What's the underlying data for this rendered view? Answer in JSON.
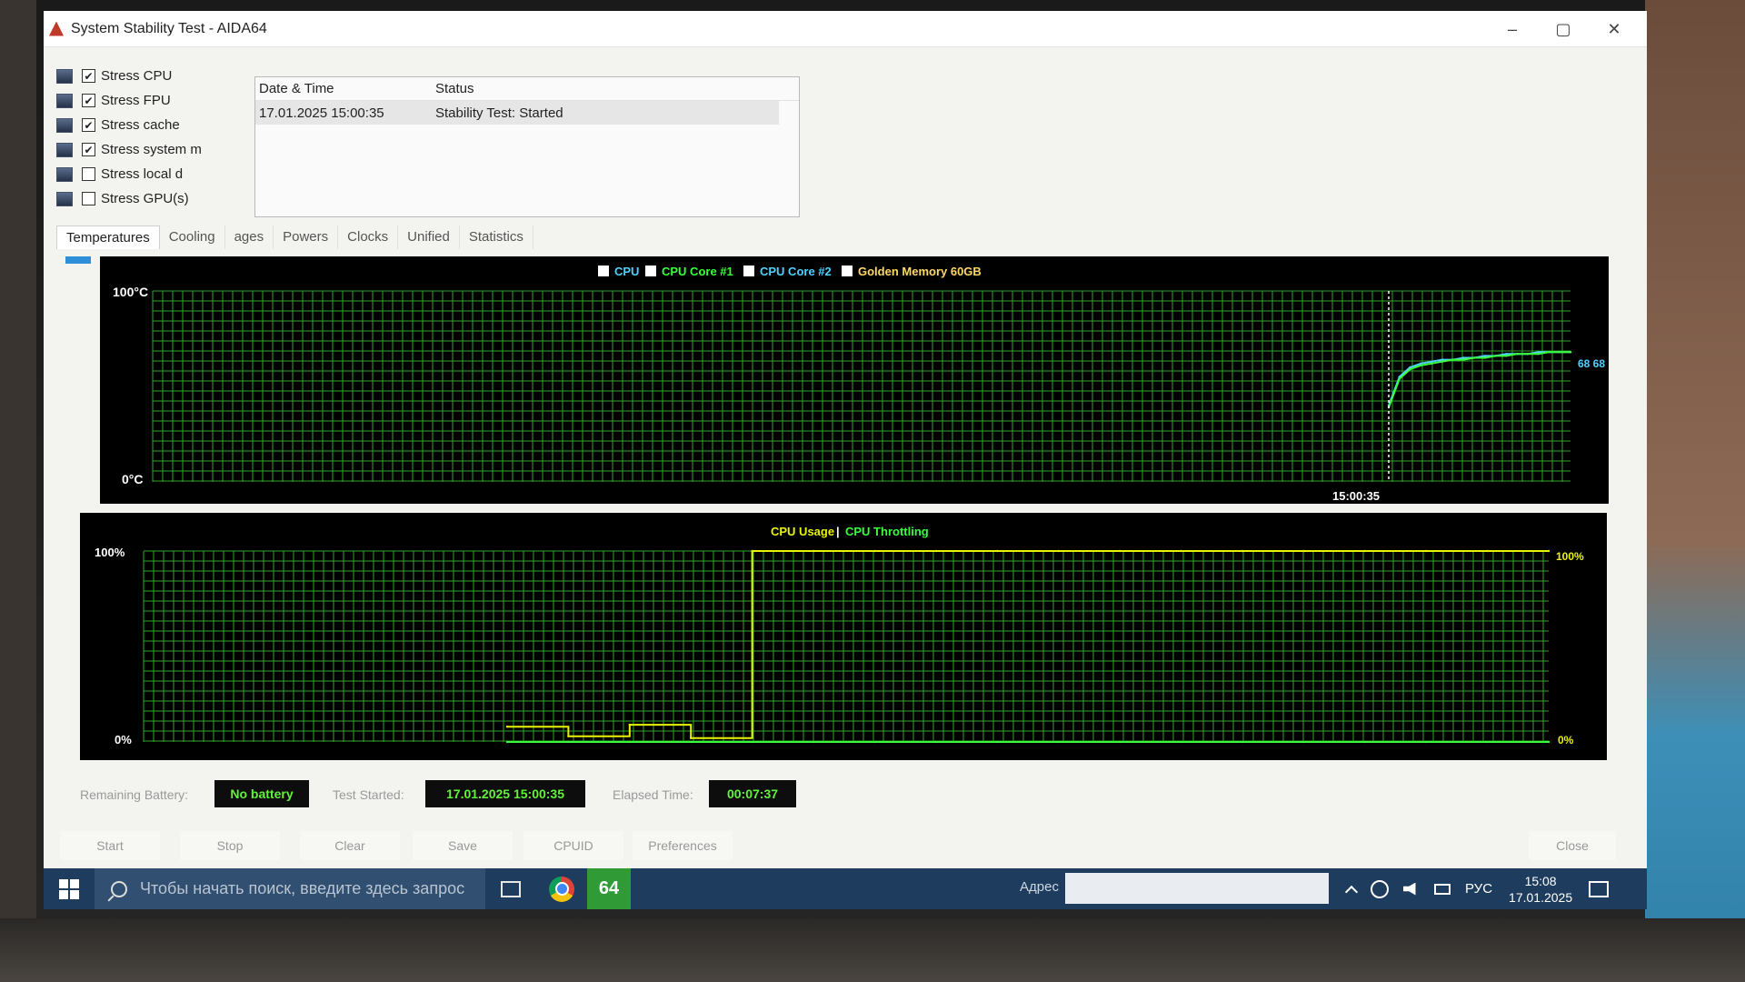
{
  "window": {
    "title": "System Stability Test - AIDA64",
    "controls": [
      "–",
      "▢",
      "✕"
    ]
  },
  "stress_options": [
    {
      "label": "Stress CPU",
      "checked": true,
      "icon": "cpu-icon"
    },
    {
      "label": "Stress FPU",
      "checked": true,
      "icon": "fpu-icon"
    },
    {
      "label": "Stress cache",
      "checked": true,
      "icon": "cache-icon"
    },
    {
      "label": "Stress system m",
      "checked": true,
      "icon": "memory-icon"
    },
    {
      "label": "Stress local d",
      "checked": false,
      "icon": "disk-icon"
    },
    {
      "label": "Stress GPU(s)",
      "checked": false,
      "icon": "gpu-icon"
    }
  ],
  "log": {
    "headers": {
      "datetime": "Date & Time",
      "status": "Status"
    },
    "rows": [
      {
        "datetime": "17.01.2025 15:00:35",
        "status": "Stability Test: Started"
      }
    ]
  },
  "tabs": [
    "Temperatures",
    "Cooling",
    "ages",
    "Powers",
    "Clocks",
    "Unified",
    "Statistics"
  ],
  "temperature_chart": {
    "legend": [
      {
        "label": "CPU",
        "checked": true,
        "color": "#4fd1ff"
      },
      {
        "label": "CPU Core #1",
        "checked": true,
        "color": "#39ff3a"
      },
      {
        "label": "CPU Core #2",
        "checked": true,
        "color": "#4fd1ff"
      },
      {
        "label": "Golden Memory 60GB",
        "checked": false,
        "color": "#ffd966"
      }
    ],
    "y_top_label": "100°C",
    "y_bottom_label": "0°C",
    "marker_time_label": "15:00:35",
    "value_label": "68 68"
  },
  "cpu_chart": {
    "title_usage": "CPU Usage",
    "title_sep": "|",
    "title_throttling": "CPU Throttling",
    "y_top_label": "100%",
    "y_bottom_label": "0%",
    "right_top_label": "100%",
    "right_bottom_label": "0%"
  },
  "chart_data": [
    {
      "type": "line",
      "title": "",
      "ylim": [
        0,
        100
      ],
      "ylabel": "°C",
      "grid": true,
      "marker_time": "15:00:35",
      "series": [
        {
          "name": "CPU",
          "color": "#4fd1ff",
          "values": [
            40,
            55,
            60,
            62,
            63,
            64,
            64,
            65,
            65,
            66,
            66,
            67,
            67,
            67,
            68,
            68,
            68,
            68
          ]
        },
        {
          "name": "CPU Core #1",
          "color": "#39ff3a",
          "values": [
            39,
            54,
            59,
            61,
            62,
            63,
            64,
            64,
            65,
            65,
            66,
            66,
            67,
            67,
            67,
            68,
            68,
            68
          ]
        }
      ]
    },
    {
      "type": "line",
      "title": "",
      "ylim": [
        0,
        100
      ],
      "ylabel": "%",
      "grid": true,
      "series": [
        {
          "name": "CPU Usage",
          "color": "#e8f400",
          "values": [
            8,
            3,
            9,
            2,
            100,
            100,
            100,
            100,
            100,
            100,
            100,
            100,
            100,
            100,
            100,
            100,
            100,
            100
          ]
        },
        {
          "name": "CPU Throttling",
          "color": "#39ff3a",
          "values": [
            0,
            0,
            0,
            0,
            0,
            0,
            0,
            0,
            0,
            0,
            0,
            0,
            0,
            0,
            0,
            0,
            0,
            0
          ]
        }
      ]
    }
  ],
  "status_bar": {
    "battery_label": "Remaining Battery:",
    "battery_value": "No battery",
    "test_started_label": "Test Started:",
    "test_started_value": "17.01.2025 15:00:35",
    "elapsed_label": "Elapsed Time:",
    "elapsed_value": "00:07:37"
  },
  "buttons": {
    "start": "Start",
    "stop": "Stop",
    "clear": "Clear",
    "save": "Save",
    "cpuid": "CPUID",
    "preferences": "Preferences",
    "close": "Close"
  },
  "taskbar": {
    "search_placeholder": "Чтобы начать поиск, введите здесь запрос",
    "aida_label": "64",
    "address_label": "Адрес",
    "language": "РУС",
    "time": "15:08",
    "date": "17.01.2025"
  }
}
